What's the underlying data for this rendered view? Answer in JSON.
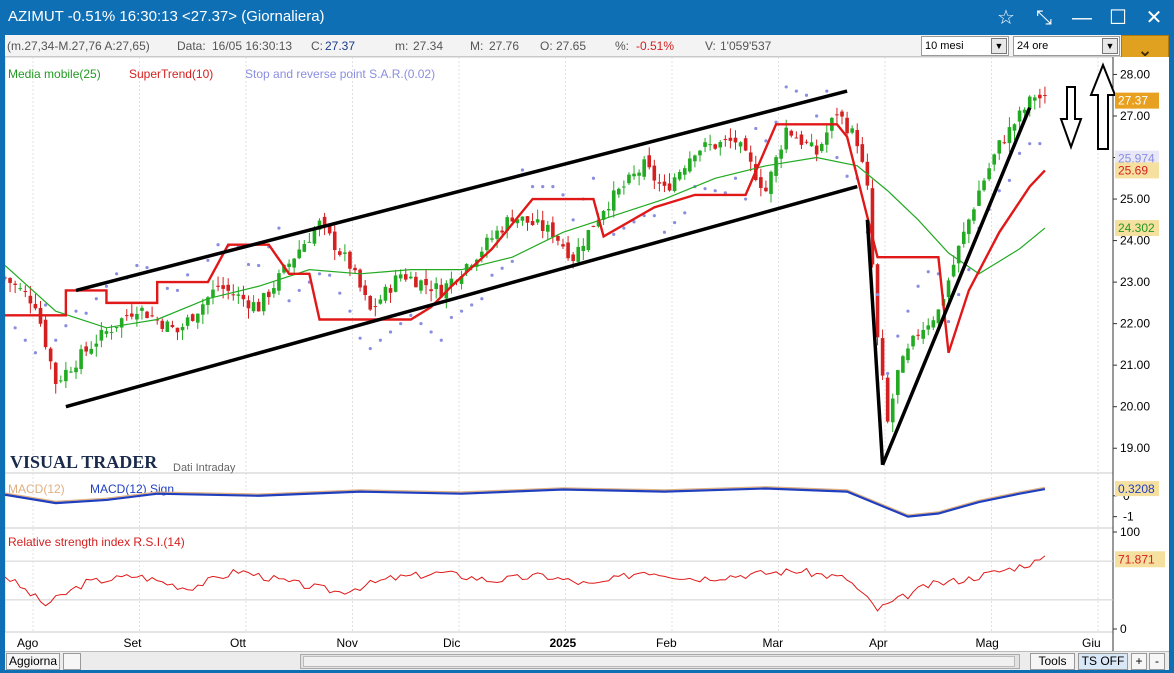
{
  "window": {
    "title": "AZIMUT -0.51% 16:30:13  <27.37> (Giornaliera)",
    "buttons": [
      "☆",
      "⤡",
      "—",
      "☐",
      "✕"
    ]
  },
  "infobar": {
    "range": "(m.27,34-M.27,76 A:27,65)",
    "data_label": "Data:",
    "data_value": "16/05 16:30:13",
    "close_label": "C:",
    "close_value": "27.37",
    "min_label": "m:",
    "min_value": "27.34",
    "max_label": "M:",
    "max_value": "27.76",
    "open_label": "O:",
    "open_value": "27.65",
    "pct_label": "%:",
    "pct_value": "-0.51%",
    "vol_label": "V:",
    "vol_value": "1'059'537",
    "period_select": "10 mesi",
    "interval_select": "24 ore"
  },
  "legend": {
    "ma": "Media mobile(25)",
    "supertrend": "SuperTrend(10)",
    "sar": "Stop and reverse point S.A.R.(0.02)",
    "macd": "MACD(12)",
    "macd_sign": "MACD(12) Sign",
    "rsi": "Relative strength index R.S.I.(14)"
  },
  "watermark": {
    "brand": "VISUAL TRADER",
    "sub": "Dati Intraday"
  },
  "price_labels": {
    "last": "27.37",
    "sar": "25.974",
    "supertrend": "25.69",
    "ma": "24.302",
    "macd": "0.3208",
    "rsi": "71.871"
  },
  "colors": {
    "up": "#22aa22",
    "down": "#d42020",
    "supertrend": "#e01818",
    "ma": "#22aa22",
    "sar": "#8a8ee0",
    "macd": "#1f3fbf",
    "macd_sig": "#e0b080",
    "rsi": "#e01818",
    "drawing": "#000000"
  },
  "statusbar": {
    "refresh": "Aggiorna",
    "tools": "Tools",
    "ts": "TS OFF",
    "plus": "+",
    "minus": "-"
  },
  "chart_data": {
    "type": "candlestick",
    "y_ticks": [
      28.0,
      27.0,
      26.0,
      25.0,
      24.0,
      23.0,
      22.0,
      21.0,
      20.0,
      19.0
    ],
    "y_range": [
      18.5,
      28.3
    ],
    "x_ticks": [
      {
        "label": "Ago",
        "bold": false
      },
      {
        "label": "Set",
        "bold": false
      },
      {
        "label": "Ott",
        "bold": false
      },
      {
        "label": "Nov",
        "bold": false
      },
      {
        "label": "Dic",
        "bold": false
      },
      {
        "label": "2025",
        "bold": true
      },
      {
        "label": "Feb",
        "bold": false
      },
      {
        "label": "Mar",
        "bold": false
      },
      {
        "label": "Apr",
        "bold": false
      },
      {
        "label": "Mag",
        "bold": false
      },
      {
        "label": "Giu",
        "bold": false
      }
    ],
    "close_path": [
      [
        0,
        23.1
      ],
      [
        6,
        22.5
      ],
      [
        10,
        20.6
      ],
      [
        18,
        21.6
      ],
      [
        26,
        22.4
      ],
      [
        34,
        21.8
      ],
      [
        42,
        22.9
      ],
      [
        50,
        22.4
      ],
      [
        58,
        23.8
      ],
      [
        62,
        24.4
      ],
      [
        68,
        23.4
      ],
      [
        72,
        22.3
      ],
      [
        78,
        23.2
      ],
      [
        86,
        22.8
      ],
      [
        94,
        23.8
      ],
      [
        100,
        24.6
      ],
      [
        108,
        24.2
      ],
      [
        112,
        23.6
      ],
      [
        118,
        24.8
      ],
      [
        126,
        25.8
      ],
      [
        130,
        25.2
      ],
      [
        136,
        26.2
      ],
      [
        144,
        26.4
      ],
      [
        150,
        25.2
      ],
      [
        154,
        26.7
      ],
      [
        160,
        26.1
      ],
      [
        164,
        27.1
      ],
      [
        168,
        26.4
      ],
      [
        170,
        25.2
      ],
      [
        172,
        21.6
      ],
      [
        174,
        19.6
      ],
      [
        176,
        20.8
      ],
      [
        180,
        21.8
      ],
      [
        184,
        22.3
      ],
      [
        188,
        23.8
      ],
      [
        192,
        25.2
      ],
      [
        196,
        26.3
      ],
      [
        200,
        27.0
      ],
      [
        203,
        27.5
      ],
      [
        205,
        27.37
      ]
    ],
    "supertrend_steps": [
      [
        0,
        22.2
      ],
      [
        12,
        22.2
      ],
      [
        12,
        22.8
      ],
      [
        20,
        22.8
      ],
      [
        20,
        22.5
      ],
      [
        30,
        22.5
      ],
      [
        30,
        23.0
      ],
      [
        40,
        23.0
      ],
      [
        44,
        23.9
      ],
      [
        52,
        23.9
      ],
      [
        56,
        23.2
      ],
      [
        60,
        23.2
      ],
      [
        62,
        22.1
      ],
      [
        80,
        22.1
      ],
      [
        84,
        22.4
      ],
      [
        88,
        22.9
      ],
      [
        96,
        23.8
      ],
      [
        104,
        25.0
      ],
      [
        116,
        25.0
      ],
      [
        118,
        24.1
      ],
      [
        128,
        24.8
      ],
      [
        136,
        25.1
      ],
      [
        146,
        25.1
      ],
      [
        152,
        26.8
      ],
      [
        164,
        26.8
      ],
      [
        166,
        26.5
      ],
      [
        172,
        23.6
      ],
      [
        184,
        23.6
      ],
      [
        186,
        21.3
      ],
      [
        190,
        22.8
      ],
      [
        196,
        24.2
      ],
      [
        202,
        25.3
      ],
      [
        205,
        25.69
      ]
    ],
    "ma_path": [
      [
        0,
        23.4
      ],
      [
        10,
        22.3
      ],
      [
        20,
        21.9
      ],
      [
        30,
        22.1
      ],
      [
        40,
        22.6
      ],
      [
        50,
        22.9
      ],
      [
        60,
        23.3
      ],
      [
        70,
        23.2
      ],
      [
        80,
        23.3
      ],
      [
        90,
        23.3
      ],
      [
        100,
        23.6
      ],
      [
        110,
        24.2
      ],
      [
        120,
        24.6
      ],
      [
        130,
        25.0
      ],
      [
        140,
        25.5
      ],
      [
        150,
        25.8
      ],
      [
        160,
        26.0
      ],
      [
        168,
        25.8
      ],
      [
        174,
        25.2
      ],
      [
        180,
        24.5
      ],
      [
        186,
        23.7
      ],
      [
        192,
        23.2
      ],
      [
        196,
        23.5
      ],
      [
        200,
        23.8
      ],
      [
        205,
        24.302
      ]
    ],
    "macd_path": [
      [
        0,
        0.05
      ],
      [
        10,
        -0.35
      ],
      [
        20,
        -0.2
      ],
      [
        30,
        0.1
      ],
      [
        50,
        0.0
      ],
      [
        70,
        0.2
      ],
      [
        90,
        0.1
      ],
      [
        110,
        0.3
      ],
      [
        130,
        0.2
      ],
      [
        150,
        0.35
      ],
      [
        166,
        0.2
      ],
      [
        172,
        -0.4
      ],
      [
        178,
        -1.0
      ],
      [
        184,
        -0.85
      ],
      [
        192,
        -0.3
      ],
      [
        200,
        0.1
      ],
      [
        205,
        0.3208
      ]
    ],
    "rsi_path": [
      [
        0,
        55
      ],
      [
        8,
        25
      ],
      [
        16,
        48
      ],
      [
        26,
        55
      ],
      [
        36,
        42
      ],
      [
        46,
        60
      ],
      [
        56,
        48
      ],
      [
        66,
        38
      ],
      [
        76,
        52
      ],
      [
        86,
        58
      ],
      [
        96,
        50
      ],
      [
        106,
        55
      ],
      [
        116,
        45
      ],
      [
        126,
        60
      ],
      [
        136,
        52
      ],
      [
        146,
        56
      ],
      [
        156,
        60
      ],
      [
        166,
        52
      ],
      [
        172,
        20
      ],
      [
        176,
        30
      ],
      [
        182,
        45
      ],
      [
        190,
        52
      ],
      [
        198,
        62
      ],
      [
        205,
        71.871
      ]
    ],
    "drawing_lines": [
      {
        "x1": 12,
        "y1": 20.0,
        "x2": 168,
        "y2": 25.3
      },
      {
        "x1": 14,
        "y1": 22.8,
        "x2": 166,
        "y2": 27.6
      },
      {
        "x1": 170,
        "y1": 24.5,
        "x2": 173,
        "y2": 18.6
      },
      {
        "x1": 173,
        "y1": 18.6,
        "x2": 202,
        "y2": 27.2
      }
    ]
  }
}
